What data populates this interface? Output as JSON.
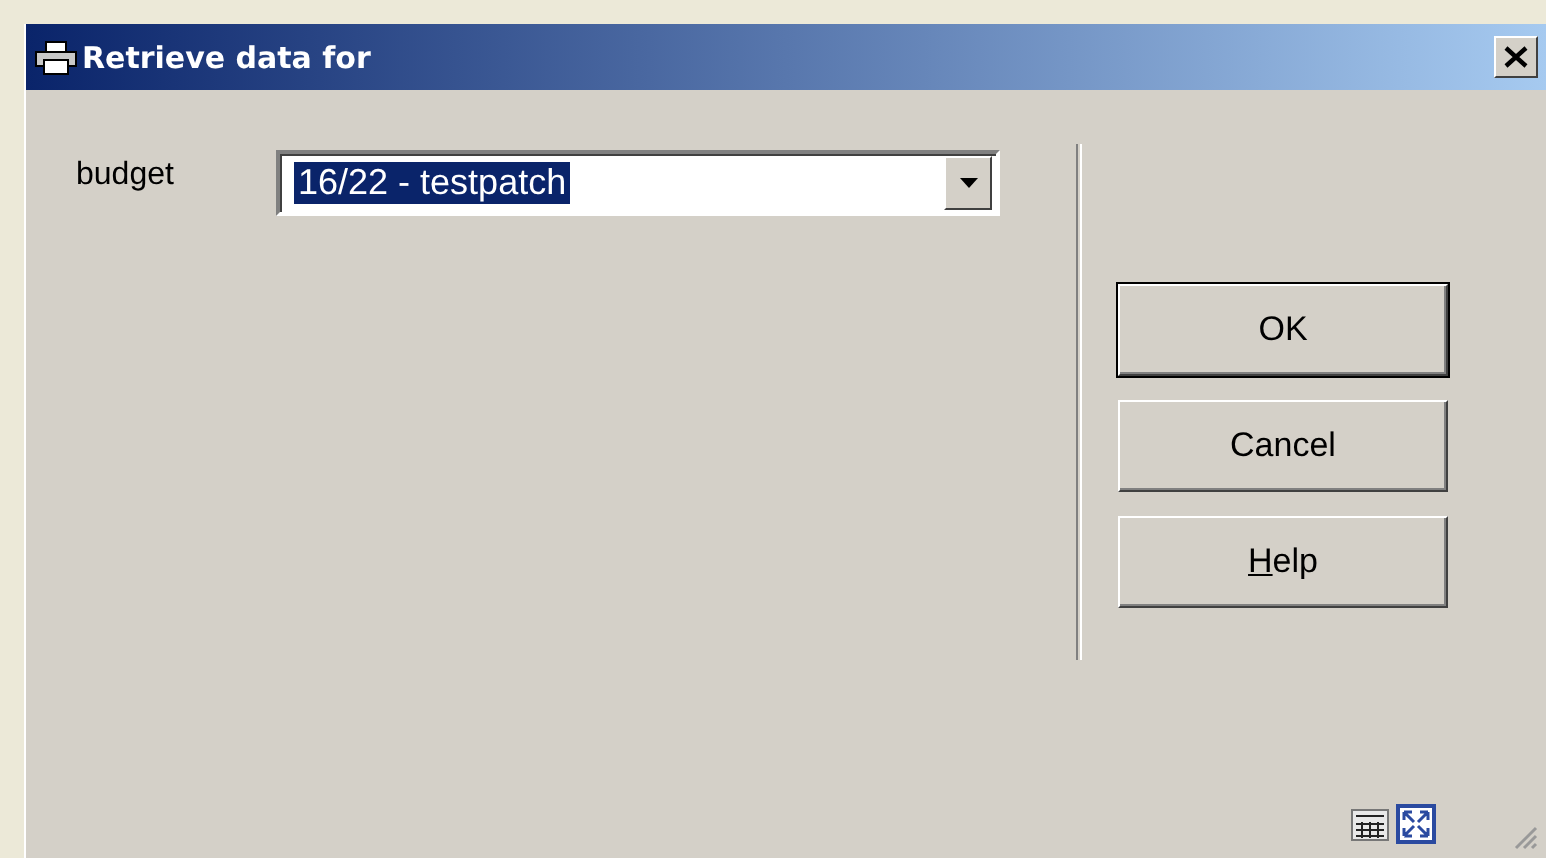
{
  "window": {
    "title": "Retrieve data for"
  },
  "fields": [
    {
      "label": "budget",
      "value": "16/22 - testpatch",
      "selected": true
    }
  ],
  "buttons": [
    {
      "label": "OK",
      "default": true,
      "mnemonic": false
    },
    {
      "label": "Cancel",
      "default": false,
      "mnemonic": false
    },
    {
      "label": "Help",
      "default": false,
      "mnemonic": true
    }
  ]
}
